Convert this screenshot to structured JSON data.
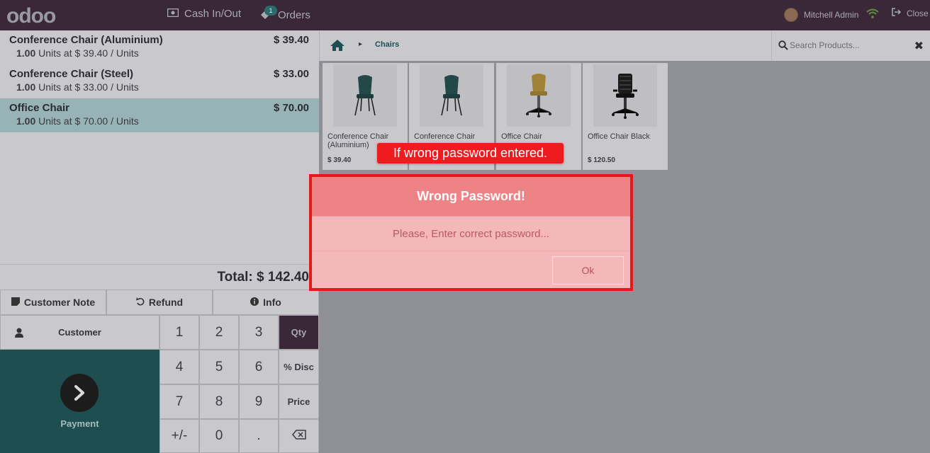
{
  "header": {
    "logo": "odoo",
    "cash_label": "Cash In/Out",
    "orders_label": "Orders",
    "orders_badge": "1",
    "user_name": "Mitchell Admin",
    "close_label": "Close"
  },
  "order": {
    "lines": [
      {
        "name": "Conference Chair (Aluminium)",
        "price": "$ 39.40",
        "qty": "1.00",
        "detail": "Units at $ 39.40 / Units",
        "selected": false
      },
      {
        "name": "Conference Chair (Steel)",
        "price": "$ 33.00",
        "qty": "1.00",
        "detail": "Units at $ 33.00 / Units",
        "selected": false
      },
      {
        "name": "Office Chair",
        "price": "$ 70.00",
        "qty": "1.00",
        "detail": "Units at $ 70.00 / Units",
        "selected": true
      }
    ],
    "total": "Total: $ 142.40"
  },
  "controls": {
    "customer_note": "Customer Note",
    "refund": "Refund",
    "info": "Info",
    "customer": "Customer",
    "payment": "Payment"
  },
  "numpad": {
    "k1": "1",
    "k2": "2",
    "k3": "3",
    "qty": "Qty",
    "k4": "4",
    "k5": "5",
    "k6": "6",
    "disc": "% Disc",
    "k7": "7",
    "k8": "8",
    "k9": "9",
    "price": "Price",
    "sign": "+/-",
    "k0": "0",
    "dot": "."
  },
  "products": {
    "breadcrumb": "Chairs",
    "search_placeholder": "Search Products...",
    "items": [
      {
        "name": "Conference Chair (Aluminium)",
        "price": "$ 39.40"
      },
      {
        "name": "Conference Chair",
        "price": ""
      },
      {
        "name": "Office Chair",
        "price": ""
      },
      {
        "name": "Office Chair Black",
        "price": "$ 120.50"
      }
    ]
  },
  "annotation": "If wrong password entered.",
  "dialog": {
    "title": "Wrong Password!",
    "message": "Please, Enter correct password...",
    "ok": "Ok"
  },
  "colors": {
    "topbar": "#3a2838",
    "payment": "#1e4e4f",
    "dialog_border": "#e11a1c",
    "annotation": "#ee1b1f"
  }
}
